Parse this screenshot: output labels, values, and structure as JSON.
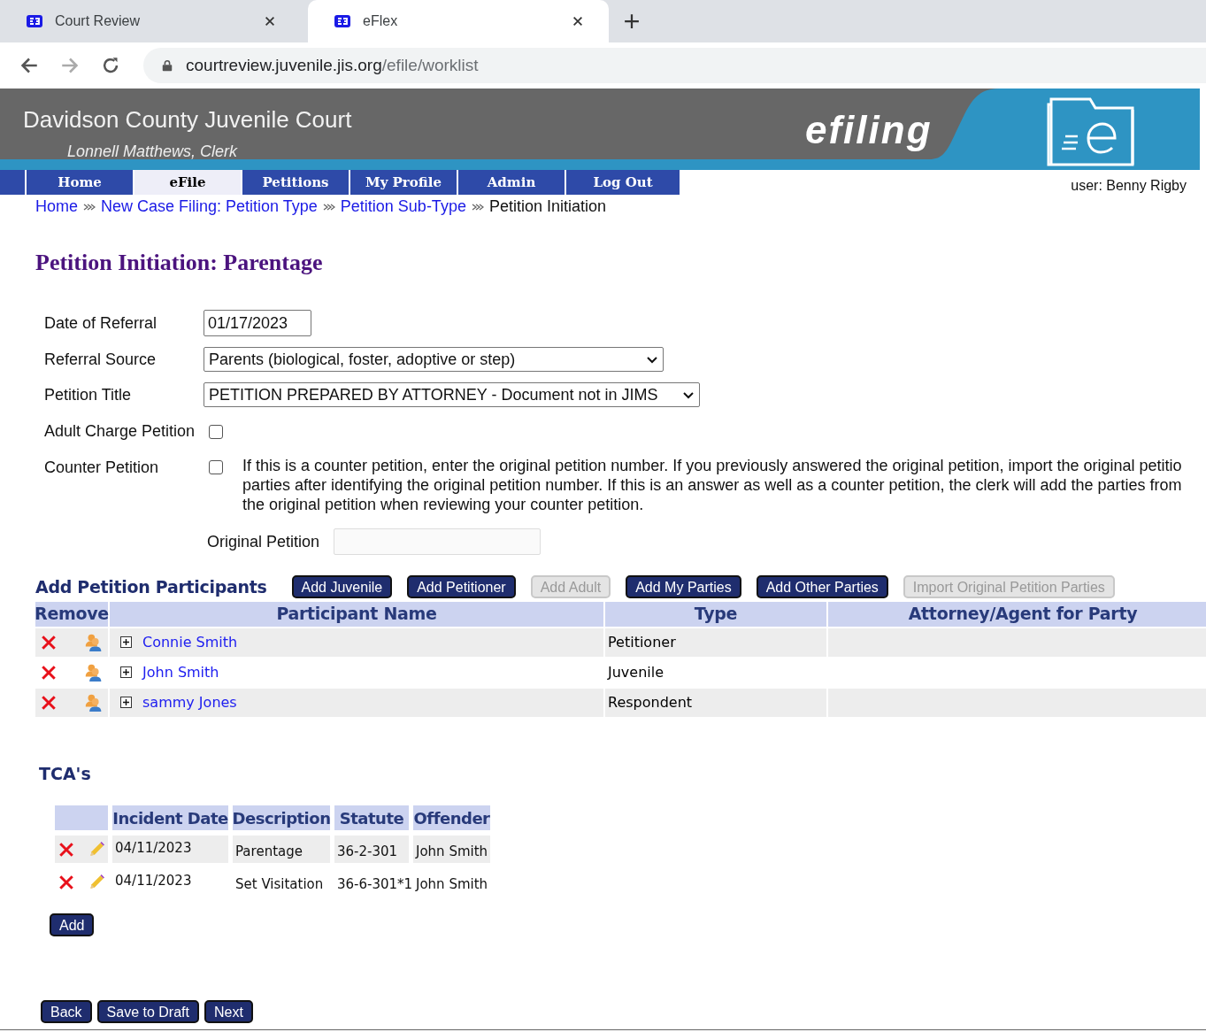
{
  "browser": {
    "tabs": [
      {
        "title": "Court Review",
        "selected": false
      },
      {
        "title": "eFlex",
        "selected": true
      }
    ],
    "url": {
      "host": "courtreview.juvenile.jis.org",
      "path": "/efile/worklist"
    }
  },
  "header": {
    "title": "Davidson County Juvenile Court",
    "clerk": "Lonnell Matthews, Clerk",
    "brand": "efiling"
  },
  "nav": [
    {
      "label": "Home",
      "selected": false
    },
    {
      "label": "eFile",
      "selected": true
    },
    {
      "label": "Petitions",
      "selected": false
    },
    {
      "label": "My Profile",
      "selected": false
    },
    {
      "label": "Admin",
      "selected": false
    },
    {
      "label": "Log Out",
      "selected": false
    }
  ],
  "user": "user: Benny Rigby",
  "breadcrumb": [
    {
      "label": "Home",
      "kind": "link"
    },
    {
      "label": "New Case Filing: Petition Type",
      "kind": "link"
    },
    {
      "label": "Petition Sub-Type",
      "kind": "link"
    },
    {
      "label": "Petition Initiation",
      "kind": "current"
    }
  ],
  "heading": "Petition Initiation: Parentage",
  "form": {
    "date_of_referral": {
      "label": "Date of Referral",
      "value": "01/17/2023"
    },
    "referral_source": {
      "label": "Referral Source",
      "value": "Parents (biological, foster, adoptive or step)"
    },
    "petition_title": {
      "label": "Petition Title",
      "value": "PETITION PREPARED BY ATTORNEY - Document not in JIMS"
    },
    "adult_charge_petition": {
      "label": "Adult Charge Petition",
      "checked": false
    },
    "counter_petition": {
      "label": "Counter Petition",
      "checked": false,
      "note_lines": [
        "If this is a counter petition, enter the original petition number. If you previously answered the original petition, import the original petitio",
        "parties after identifying the original petition number. If this is an answer as well as a counter petition, the clerk will add the parties from",
        "the original petition when reviewing your counter petition."
      ]
    },
    "original_petition": {
      "label": "Original Petition"
    }
  },
  "participants": {
    "title": "Add Petition Participants",
    "buttons": [
      {
        "label": "Add Juvenile",
        "disabled": false
      },
      {
        "label": "Add Petitioner",
        "disabled": false
      },
      {
        "label": "Add Adult",
        "disabled": true
      },
      {
        "label": "Add My Parties",
        "disabled": false
      },
      {
        "label": "Add Other Parties",
        "disabled": false
      },
      {
        "label": "Import Original Petition Parties",
        "disabled": true
      }
    ],
    "columns": [
      "Remove",
      "Participant Name",
      "Type",
      "Attorney/Agent for Party"
    ],
    "rows": [
      {
        "name": "Connie Smith",
        "type": "Petitioner"
      },
      {
        "name": "John Smith",
        "type": "Juvenile"
      },
      {
        "name": "sammy Jones",
        "type": "Respondent"
      }
    ]
  },
  "tcas": {
    "title": "TCA's",
    "columns": [
      "Incident Date",
      "Description",
      "Statute",
      "Offender"
    ],
    "rows": [
      {
        "incident_date": "04/11/2023",
        "description": "Parentage",
        "statute": "36-2-301",
        "offender": "John Smith"
      },
      {
        "incident_date": "04/11/2023",
        "description": "Set Visitation",
        "statute": "36-6-301*1",
        "offender": "John Smith"
      }
    ],
    "add_button": "Add"
  },
  "footer_buttons": [
    "Back",
    "Save to Draft",
    "Next"
  ]
}
